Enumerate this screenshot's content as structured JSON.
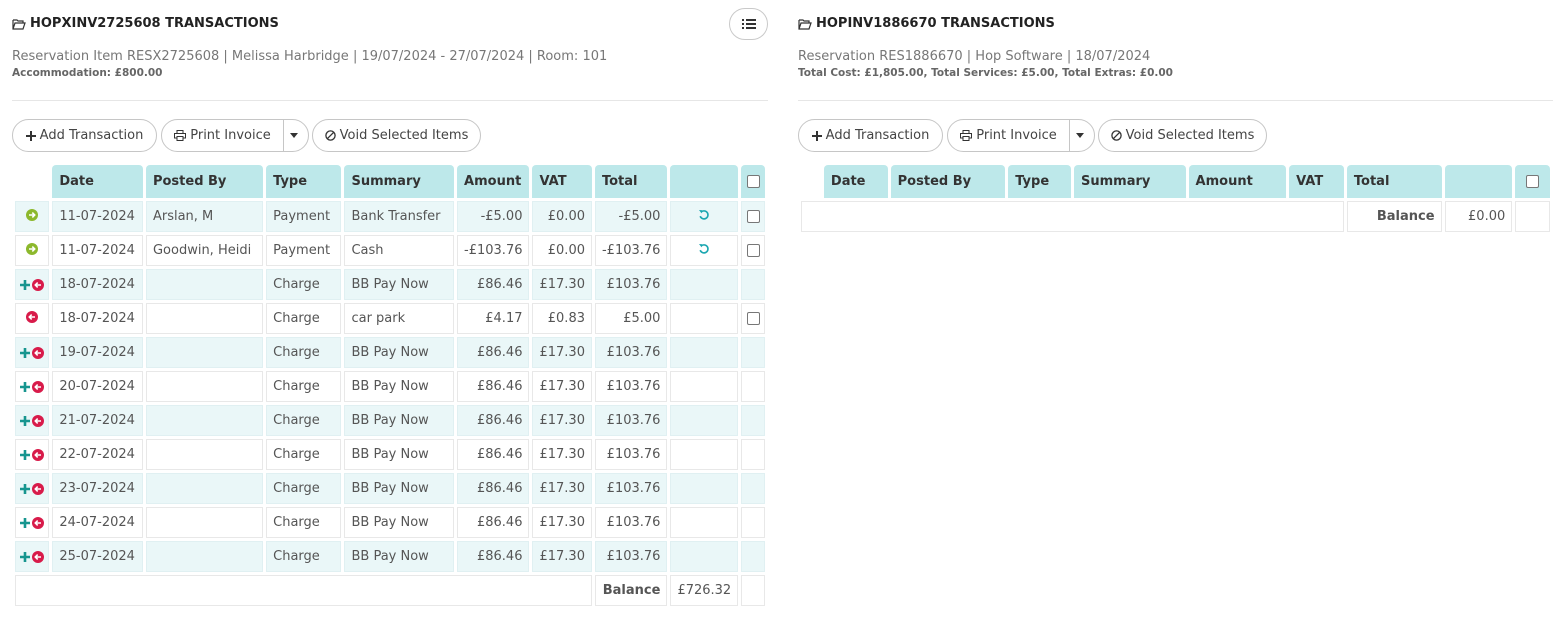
{
  "left": {
    "title": "HOPXINV2725608 TRANSACTIONS",
    "subtitle": "Reservation Item RESX2725608 | Melissa Harbridge | 19/07/2024 - 27/07/2024 | Room: 101",
    "note": "Accommodation: £800.00",
    "toolbar": {
      "add": "Add Transaction",
      "print": "Print Invoice",
      "void": "Void Selected Items"
    },
    "columns": [
      "Date",
      "Posted By",
      "Type",
      "Summary",
      "Amount",
      "VAT",
      "Total"
    ],
    "rows": [
      {
        "icon": "arrow-right-circle-icon",
        "date": "11-07-2024",
        "posted_by": "Arslan, M",
        "type": "Payment",
        "summary": "Bank Transfer",
        "amount": "-£5.00",
        "vat": "£0.00",
        "total": "-£5.00",
        "action": "undo-icon",
        "checkbox": true
      },
      {
        "icon": "arrow-right-circle-icon",
        "date": "11-07-2024",
        "posted_by": "Goodwin, Heidi",
        "type": "Payment",
        "summary": "Cash",
        "amount": "-£103.76",
        "vat": "£0.00",
        "total": "-£103.76",
        "action": "undo-icon",
        "checkbox": true
      },
      {
        "icon": "plus-arrow-left-icon",
        "date": "18-07-2024",
        "posted_by": "",
        "type": "Charge",
        "summary": "BB Pay Now",
        "amount": "£86.46",
        "vat": "£17.30",
        "total": "£103.76",
        "action": "",
        "checkbox": false
      },
      {
        "icon": "arrow-left-circle-icon",
        "date": "18-07-2024",
        "posted_by": "",
        "type": "Charge",
        "summary": "car park",
        "amount": "£4.17",
        "vat": "£0.83",
        "total": "£5.00",
        "action": "",
        "checkbox": true
      },
      {
        "icon": "plus-arrow-left-icon",
        "date": "19-07-2024",
        "posted_by": "",
        "type": "Charge",
        "summary": "BB Pay Now",
        "amount": "£86.46",
        "vat": "£17.30",
        "total": "£103.76",
        "action": "",
        "checkbox": false
      },
      {
        "icon": "plus-arrow-left-icon",
        "date": "20-07-2024",
        "posted_by": "",
        "type": "Charge",
        "summary": "BB Pay Now",
        "amount": "£86.46",
        "vat": "£17.30",
        "total": "£103.76",
        "action": "",
        "checkbox": false
      },
      {
        "icon": "plus-arrow-left-icon",
        "date": "21-07-2024",
        "posted_by": "",
        "type": "Charge",
        "summary": "BB Pay Now",
        "amount": "£86.46",
        "vat": "£17.30",
        "total": "£103.76",
        "action": "",
        "checkbox": false
      },
      {
        "icon": "plus-arrow-left-icon",
        "date": "22-07-2024",
        "posted_by": "",
        "type": "Charge",
        "summary": "BB Pay Now",
        "amount": "£86.46",
        "vat": "£17.30",
        "total": "£103.76",
        "action": "",
        "checkbox": false
      },
      {
        "icon": "plus-arrow-left-icon",
        "date": "23-07-2024",
        "posted_by": "",
        "type": "Charge",
        "summary": "BB Pay Now",
        "amount": "£86.46",
        "vat": "£17.30",
        "total": "£103.76",
        "action": "",
        "checkbox": false
      },
      {
        "icon": "plus-arrow-left-icon",
        "date": "24-07-2024",
        "posted_by": "",
        "type": "Charge",
        "summary": "BB Pay Now",
        "amount": "£86.46",
        "vat": "£17.30",
        "total": "£103.76",
        "action": "",
        "checkbox": false
      },
      {
        "icon": "plus-arrow-left-icon",
        "date": "25-07-2024",
        "posted_by": "",
        "type": "Charge",
        "summary": "BB Pay Now",
        "amount": "£86.46",
        "vat": "£17.30",
        "total": "£103.76",
        "action": "",
        "checkbox": false
      }
    ],
    "balance_label": "Balance",
    "balance_value": "£726.32"
  },
  "right": {
    "title": "HOPINV1886670 TRANSACTIONS",
    "subtitle": "Reservation RES1886670 | Hop Software | 18/07/2024",
    "note": "Total Cost: £1,805.00, Total Services: £5.00, Total Extras: £0.00",
    "toolbar": {
      "add": "Add Transaction",
      "print": "Print Invoice",
      "void": "Void Selected Items"
    },
    "columns": [
      "Date",
      "Posted By",
      "Type",
      "Summary",
      "Amount",
      "VAT",
      "Total"
    ],
    "balance_label": "Balance",
    "balance_value": "£0.00"
  },
  "colors": {
    "header_bg": "#bde8ea",
    "row_alt_bg": "#eaf7f8",
    "payment_icon": "#8cb82c",
    "charge_icon": "#d81b4a",
    "plus_icon": "#17958f",
    "undo_icon": "#1aa6b0"
  }
}
